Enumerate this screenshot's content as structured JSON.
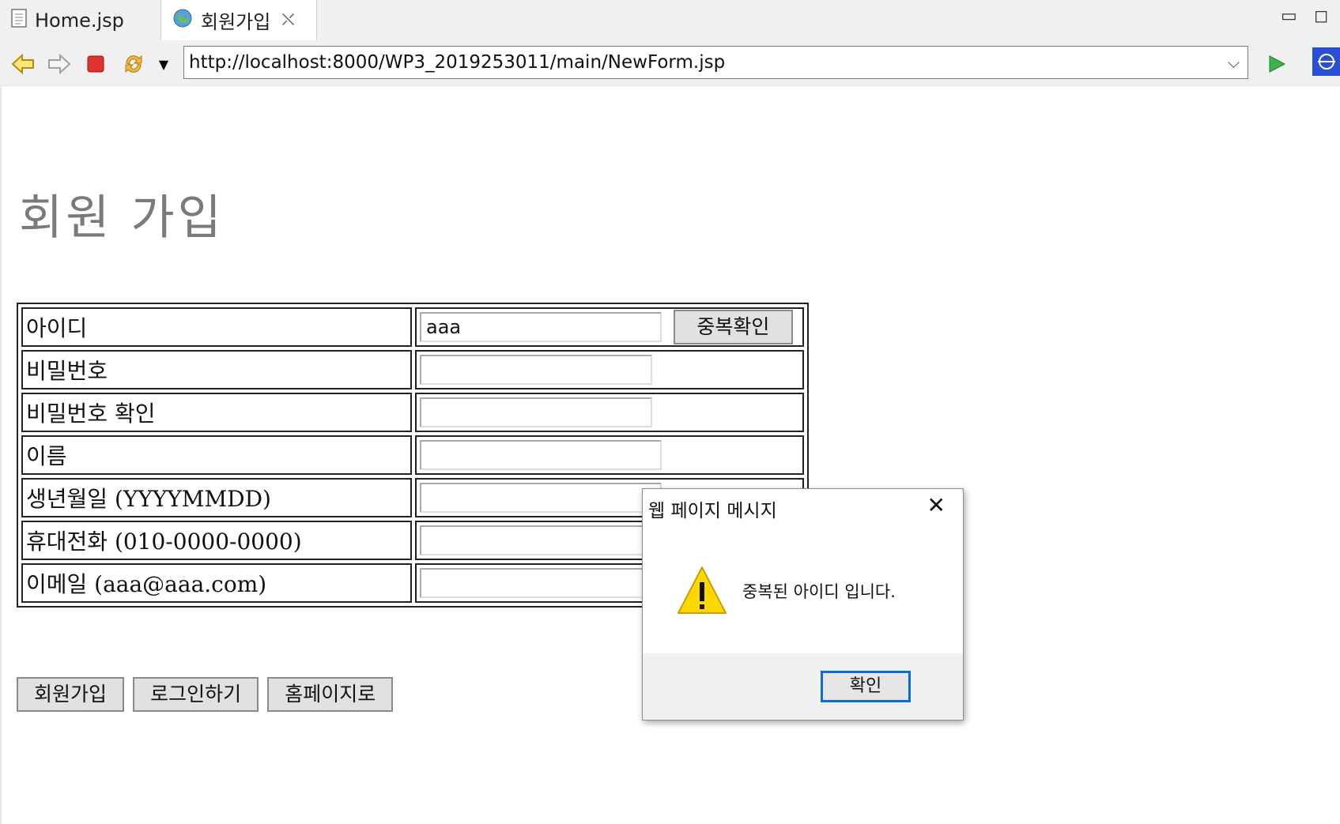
{
  "tabs": [
    {
      "label": "Home.jsp",
      "icon": "jsp-file-icon"
    },
    {
      "label": "회원가입",
      "icon": "globe-icon",
      "close": "⛌"
    }
  ],
  "toolbar": {
    "back": "back-arrow-icon",
    "forward": "forward-arrow-icon",
    "stop": "stop-icon",
    "refresh": "refresh-icon",
    "url": "http://localhost:8000/WP3_2019253011/main/NewForm.jsp",
    "go": "go-icon"
  },
  "page": {
    "title": "회원 가입",
    "rows": [
      {
        "label": "아이디",
        "value": "aaa"
      },
      {
        "label": "비밀번호",
        "value": ""
      },
      {
        "label": "비밀번호 확인",
        "value": ""
      },
      {
        "label": "이름",
        "value": ""
      },
      {
        "label": "생년월일 (YYYYMMDD)",
        "value": ""
      },
      {
        "label": "휴대전화 (010-0000-0000)",
        "value": ""
      },
      {
        "label": "이메일 (aaa@aaa.com)",
        "value": ""
      }
    ],
    "dup_check_label": "중복확인",
    "buttons": {
      "signup": "회원가입",
      "login": "로그인하기",
      "home": "홈페이지로"
    }
  },
  "dialog": {
    "title": "웹 페이지 메시지",
    "message": "중복된 아이디 입니다.",
    "ok": "확인",
    "warn_colors": {
      "fill": "#ffd700",
      "stroke": "#c8a000"
    }
  }
}
